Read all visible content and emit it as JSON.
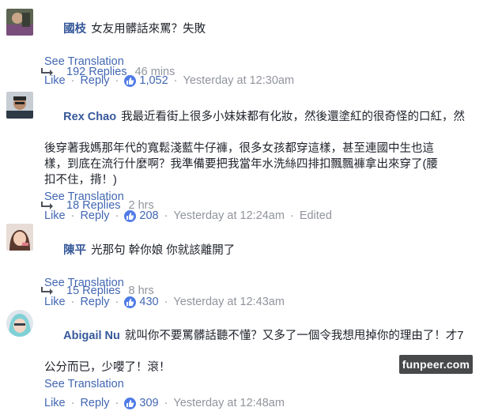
{
  "comments": [
    {
      "author": "國枝",
      "text_lines": [
        "女友用髒話來罵？失敗"
      ],
      "see_translation": "See Translation",
      "like_label": "Like",
      "reply_label": "Reply",
      "like_count": "1,052",
      "timestamp": "Yesterday at 12:30am",
      "edited": "",
      "replies": "192 Replies",
      "replies_time": "46 mins"
    },
    {
      "author": "Rex Chao",
      "text_lines": [
        "我最近看街上很多小妹妹都有化妝，然後還塗紅的很奇怪的口紅，然",
        "後穿著我媽那年代的寬鬆淺藍牛仔褲，很多女孩都穿這樣，甚至連國中生也這",
        "樣，到底在流行什麼啊？我準備要把我當年水洗絲四排扣飄飄褲拿出來穿了(腰",
        "扣不住，揹！)"
      ],
      "see_translation": "See Translation",
      "like_label": "Like",
      "reply_label": "Reply",
      "like_count": "208",
      "timestamp": "Yesterday at 12:24am",
      "edited": "Edited",
      "replies": "18 Replies",
      "replies_time": "2 hrs"
    },
    {
      "author": "陳平",
      "text_lines": [
        "光那句 幹你娘 你就該離開了"
      ],
      "see_translation": "See Translation",
      "like_label": "Like",
      "reply_label": "Reply",
      "like_count": "430",
      "timestamp": "Yesterday at 12:43am",
      "edited": "",
      "replies": "15 Replies",
      "replies_time": "8 hrs"
    },
    {
      "author": "Abigail Nu",
      "text_lines": [
        "就叫你不要罵髒話聽不懂？又多了一個令我想甩掉你的理由了！才7",
        "公分而已，少嚶了！滾！"
      ],
      "see_translation": "See Translation",
      "like_label": "Like",
      "reply_label": "Reply",
      "like_count": "309",
      "timestamp": "Yesterday at 12:48am",
      "edited": "",
      "replies": "",
      "replies_time": ""
    }
  ],
  "watermark": "funpeer.com",
  "colors": {
    "link": "#4267b2",
    "author": "#365899",
    "meta": "#90949c",
    "text": "#1d2129",
    "like_badge": "#4f7be7"
  },
  "icons": {
    "like": "thumbs-up-icon",
    "reply_arrow": "reply-arrow-icon"
  }
}
